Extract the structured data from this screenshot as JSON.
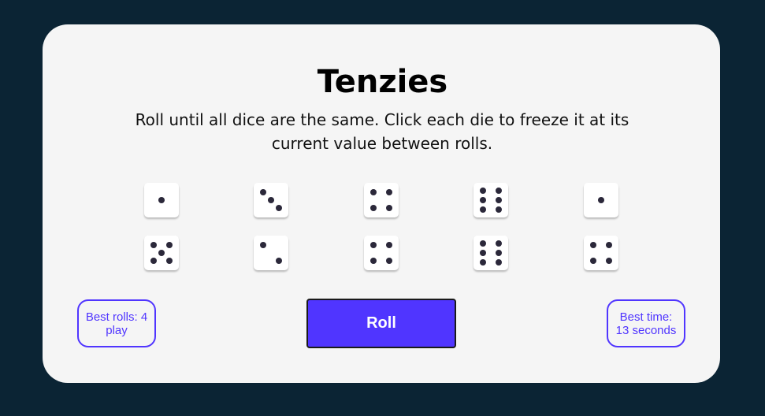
{
  "title": "Tenzies",
  "instructions": "Roll until all dice are the same. Click each die to freeze it at its current value between rolls.",
  "dice": [
    1,
    3,
    4,
    6,
    1,
    5,
    2,
    4,
    6,
    4
  ],
  "roll_label": "Roll",
  "best_rolls": {
    "line1": "Best rolls: 4",
    "line2": "play"
  },
  "best_time": {
    "line1": "Best time:",
    "line2": "13 seconds"
  },
  "colors": {
    "accent": "#5035ff",
    "background": "#0b2434",
    "card": "#f5f5f5",
    "pip": "#2b283a"
  }
}
